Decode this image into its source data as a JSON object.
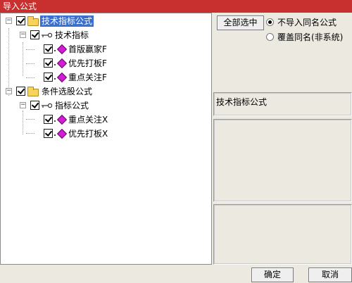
{
  "window": {
    "title": "导入公式"
  },
  "tree": {
    "groups": [
      {
        "label": "技术指标公式",
        "selected": true,
        "sub": {
          "label": "技术指标",
          "items": [
            "首版赢家F",
            "优先打板F",
            "重点关注F"
          ]
        }
      },
      {
        "label": "条件选股公式",
        "selected": false,
        "sub": {
          "label": "指标公式",
          "items": [
            "重点关注X",
            "优先打板X"
          ]
        }
      }
    ]
  },
  "options": {
    "select_all": "全部选中",
    "radio_skip": "不导入同名公式",
    "radio_overwrite": "覆盖同名(非系统)",
    "selected_radio": "skip"
  },
  "info": {
    "name": "技术指标公式",
    "description": "",
    "extra": ""
  },
  "buttons": {
    "ok": "确定",
    "cancel": "取消"
  },
  "colors": {
    "titlebar": "#c8302f",
    "selection": "#3a6fd0",
    "diamond": "#d31cd4",
    "folder": "#f7d35a"
  }
}
